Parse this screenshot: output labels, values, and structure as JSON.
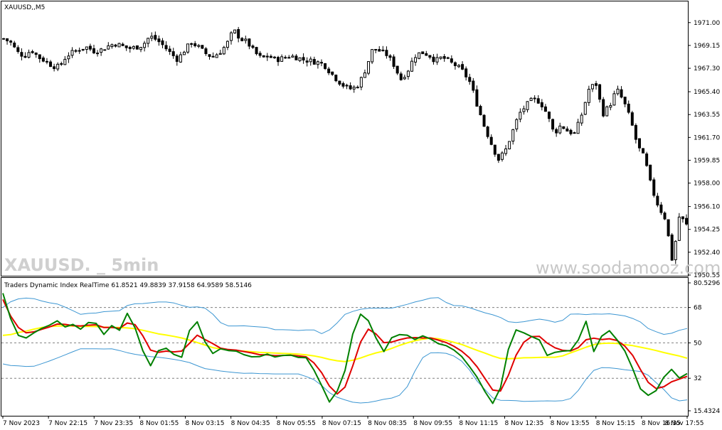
{
  "main_panel": {
    "symbol_label": "XAUUSD,,M5",
    "watermark_left": "XAUUSD. _ 5min",
    "watermark_right": "www.soodamooz.com"
  },
  "indicator_panel": {
    "title": "Traders Dynamic Index RealTime 61.8521 49.8839 37.9158 64.9589 58.5146"
  },
  "chart_data": [
    {
      "type": "candlestick",
      "ylim": [
        1950.55,
        1972.6
      ],
      "y_ticks": [
        "1971.00",
        "1969.15",
        "1967.30",
        "1965.40",
        "1963.55",
        "1961.70",
        "1959.85",
        "1958.00",
        "1956.10",
        "1954.25",
        "1952.40",
        "1950.55"
      ],
      "close_path": [
        1969.7,
        1969.4,
        1968.6,
        1968.3,
        1968.8,
        1968.2,
        1967.9,
        1967.5,
        1967.4,
        1968.3,
        1968.6,
        1968.9,
        1969.0,
        1968.7,
        1968.8,
        1969.1,
        1969.3,
        1969.1,
        1968.9,
        1969.0,
        1969.2,
        1969.9,
        1969.6,
        1969.1,
        1968.5,
        1968.0,
        1968.8,
        1969.4,
        1969.0,
        1968.5,
        1968.2,
        1968.6,
        1969.2,
        1970.4,
        1969.7,
        1969.4,
        1968.6,
        1968.1,
        1968.3,
        1968.0,
        1968.1,
        1968.3,
        1968.2,
        1968.0,
        1967.9,
        1967.8,
        1967.6,
        1966.9,
        1966.3,
        1965.8,
        1965.6,
        1966.0,
        1967.3,
        1968.9,
        1968.7,
        1968.4,
        1967.6,
        1966.4,
        1967.1,
        1968.3,
        1968.6,
        1968.4,
        1967.9,
        1968.2,
        1967.8,
        1967.5,
        1967.0,
        1966.1,
        1964.3,
        1962.6,
        1961.2,
        1959.9,
        1960.6,
        1962.1,
        1963.6,
        1964.3,
        1964.8,
        1964.6,
        1963.6,
        1962.0,
        1962.7,
        1962.2,
        1962.0,
        1963.6,
        1965.6,
        1966.1,
        1963.6,
        1964.3,
        1965.6,
        1964.6,
        1963.1,
        1961.0,
        1960.0,
        1957.6,
        1956.1,
        1955.1,
        1951.6,
        1955.4,
        1954.6
      ],
      "low": 1951.1,
      "high": 1971.1,
      "categories": [
        "7 Nov 2023",
        "7 Nov 22:15",
        "7 Nov 23:35",
        "8 Nov 01:55",
        "8 Nov 03:15",
        "8 Nov 04:35",
        "8 Nov 05:55",
        "8 Nov 07:15",
        "8 Nov 08:35",
        "8 Nov 09:55",
        "8 Nov 11:15",
        "8 Nov 12:35",
        "8 Nov 13:55",
        "8 Nov 15:15",
        "8 Nov 16:35",
        "8 Nov 17:55"
      ]
    },
    {
      "type": "line",
      "ylim": [
        15.4324,
        80.5296
      ],
      "y_ticks": [
        "80.5296",
        "68",
        "50",
        "32",
        "15.4324"
      ],
      "levels": [
        68,
        50,
        32
      ],
      "series": [
        {
          "key": "price_line",
          "color": "#008000",
          "values": [
            75.3,
            62.4,
            53.8,
            52.5,
            55.1,
            57.4,
            59.0,
            61.2,
            58.1,
            59.4,
            57.0,
            60.4,
            59.9,
            54.3,
            58.8,
            56.4,
            65.0,
            57.7,
            46.0,
            38.4,
            46.0,
            47.3,
            44.1,
            42.7,
            56.3,
            60.7,
            50.5,
            44.6,
            47.0,
            46.1,
            45.8,
            44.0,
            42.9,
            43.0,
            44.3,
            42.8,
            43.6,
            43.8,
            42.6,
            42.5,
            36.2,
            28.3,
            19.9,
            25.5,
            35.9,
            54.5,
            64.6,
            61.3,
            52.4,
            45.6,
            52.6,
            54.2,
            53.9,
            51.7,
            53.6,
            52.0,
            49.6,
            48.6,
            46.4,
            43.1,
            38.0,
            32.5,
            25.2,
            19.2,
            27.1,
            46.6,
            56.6,
            55.1,
            53.2,
            51.5,
            43.6,
            45.2,
            45.8,
            46.1,
            51.5,
            61.0,
            45.6,
            53.4,
            56.2,
            51.5,
            45.8,
            36.8,
            26.6,
            23.3,
            25.7,
            32.5,
            36.5,
            32.1,
            34.4
          ]
        },
        {
          "key": "signal_line",
          "color": "#e00000",
          "values": [
            72.1,
            63.7,
            57.8,
            55.1,
            55.6,
            56.9,
            58.1,
            59.6,
            59.4,
            58.8,
            58.6,
            59.0,
            59.2,
            57.8,
            57.9,
            57.4,
            60.1,
            59.3,
            53.6,
            46.3,
            45.2,
            45.8,
            45.4,
            45.8,
            49.8,
            53.9,
            51.7,
            49.6,
            47.3,
            46.6,
            46.3,
            45.6,
            44.9,
            44.0,
            43.9,
            43.5,
            43.6,
            43.7,
            43.4,
            42.9,
            39.8,
            34.8,
            28.0,
            24.0,
            27.5,
            38.3,
            50.4,
            57.0,
            54.5,
            50.1,
            50.4,
            51.6,
            52.5,
            52.7,
            52.5,
            52.5,
            51.4,
            50.2,
            48.3,
            45.8,
            42.4,
            37.8,
            31.8,
            26.0,
            25.5,
            33.4,
            43.7,
            50.3,
            53.2,
            53.3,
            49.9,
            47.5,
            46.2,
            45.9,
            47.6,
            51.6,
            52.4,
            51.7,
            52.1,
            51.2,
            48.3,
            43.6,
            36.4,
            29.9,
            26.8,
            27.7,
            30.2,
            31.6,
            33.0
          ]
        },
        {
          "key": "middle_band",
          "color": "#ffff00",
          "values": [
            53.8,
            54.2,
            55.3,
            56.0,
            57.0,
            57.8,
            58.3,
            58.6,
            58.6,
            58.6,
            58.4,
            58.4,
            58.3,
            58.0,
            57.8,
            57.8,
            57.6,
            57.2,
            56.4,
            55.5,
            54.6,
            54.0,
            53.3,
            52.5,
            51.4,
            50.2,
            48.9,
            47.6,
            46.9,
            46.4,
            46.0,
            45.8,
            45.5,
            45.2,
            45.0,
            44.8,
            44.6,
            44.5,
            44.3,
            43.9,
            43.4,
            42.6,
            41.6,
            40.9,
            40.5,
            41.2,
            42.3,
            43.7,
            44.9,
            45.8,
            47.2,
            48.7,
            50.0,
            51.1,
            51.9,
            52.5,
            52.1,
            51.3,
            50.3,
            49.2,
            47.7,
            46.2,
            44.8,
            43.3,
            42.1,
            41.9,
            42.1,
            42.4,
            42.5,
            42.6,
            42.7,
            42.7,
            43.4,
            44.9,
            46.3,
            47.8,
            49.1,
            49.7,
            49.9,
            49.7,
            49.1,
            48.6,
            47.8,
            47.0,
            46.1,
            45.1,
            44.2,
            43.3,
            42.2
          ]
        },
        {
          "key": "upper_band",
          "color": "#3c96d2",
          "values": [
            68.0,
            70.9,
            72.4,
            72.8,
            72.5,
            71.3,
            70.4,
            69.8,
            68.2,
            66.4,
            64.5,
            65.0,
            65.2,
            65.9,
            66.1,
            66.4,
            69.0,
            69.9,
            70.0,
            70.4,
            70.8,
            70.8,
            70.3,
            69.1,
            68.1,
            68.3,
            67.7,
            64.6,
            60.3,
            58.6,
            58.6,
            58.7,
            58.4,
            58.1,
            57.8,
            56.7,
            56.7,
            56.6,
            56.3,
            56.6,
            56.6,
            54.7,
            56.6,
            60.2,
            64.5,
            66.0,
            67.1,
            67.6,
            67.7,
            67.7,
            67.7,
            68.6,
            69.6,
            70.8,
            71.7,
            72.8,
            73.0,
            70.6,
            69.0,
            68.9,
            67.9,
            66.6,
            65.3,
            64.3,
            62.9,
            60.8,
            60.4,
            60.8,
            61.5,
            62.1,
            61.5,
            60.5,
            61.5,
            64.6,
            64.7,
            64.4,
            64.7,
            64.6,
            64.8,
            64.3,
            63.7,
            62.4,
            60.6,
            57.3,
            55.7,
            54.3,
            54.9,
            56.4,
            57.3
          ]
        },
        {
          "key": "lower_band",
          "color": "#3c96d2",
          "values": [
            39.3,
            38.5,
            38.3,
            38.0,
            38.1,
            39.4,
            40.8,
            42.3,
            43.9,
            45.5,
            47.0,
            47.0,
            47.0,
            46.9,
            47.0,
            46.1,
            45.0,
            44.2,
            43.6,
            43.0,
            42.7,
            42.2,
            41.6,
            40.9,
            40.0,
            38.4,
            36.9,
            36.3,
            35.7,
            35.2,
            34.8,
            34.5,
            34.6,
            34.4,
            34.3,
            34.2,
            34.2,
            34.2,
            34.2,
            32.9,
            31.3,
            28.3,
            24.7,
            22.3,
            21.0,
            19.8,
            19.4,
            19.7,
            20.4,
            21.3,
            21.9,
            23.3,
            27.7,
            35.7,
            42.5,
            44.9,
            45.0,
            44.7,
            43.3,
            40.7,
            36.3,
            30.5,
            26.2,
            22.0,
            20.8,
            20.7,
            20.6,
            20.2,
            20.3,
            20.4,
            20.5,
            20.4,
            20.6,
            21.7,
            25.8,
            31.5,
            36.0,
            37.4,
            37.3,
            36.9,
            36.3,
            35.9,
            35.4,
            33.5,
            29.8,
            26.3,
            22.0,
            20.5,
            21.0
          ]
        }
      ]
    }
  ]
}
